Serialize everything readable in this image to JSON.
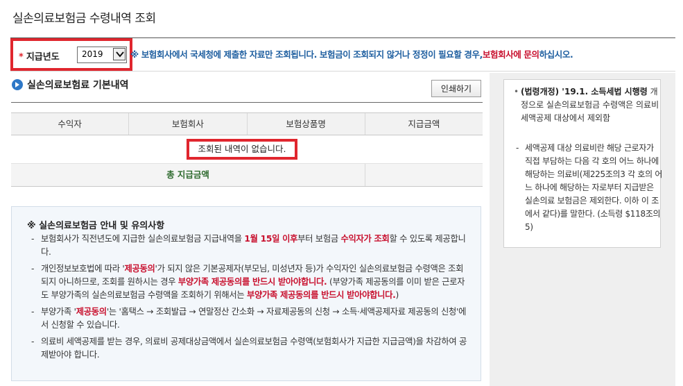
{
  "page": {
    "title": "실손의료보험금 수령내역 조회"
  },
  "filter": {
    "required_star": "*",
    "year_label": "지급년도",
    "year_value": "2019",
    "notice_part1": "※ 보험회사에서 국세청에 제출한 자료만 조회됩니다. 보험금이 조회되지 않거나 정정이 필요할 경우,",
    "notice_part2": "보험회사에 문의",
    "notice_part3": "하십시오."
  },
  "section": {
    "title": "실손의료보험료 기본내역",
    "print_label": "인쇄하기"
  },
  "table": {
    "columns": [
      "수익자",
      "보험회사",
      "보험상품명",
      "지급금액"
    ],
    "empty_text": "조회된 내역이 없습니다.",
    "total_label": "총 지급금액",
    "total_value": ""
  },
  "info": {
    "title": "※ 실손의료보험금 안내 및 유의사항",
    "item1": {
      "a": "보험회사가 직전년도에 지급한 실손의료보험금 지급내역을 ",
      "b": "1월 15일 이후",
      "c": "부터 보험금 ",
      "d": "수익자가 조회",
      "e": "할 수 있도록 제공합니다."
    },
    "item2": {
      "a": "개인정보보호법에 따라 '",
      "b": "제공동의",
      "c": "'가 되지 않은 기본공제자(부모님, 미성년자 등)가 수익자인 실손의료보험금 수령액은 조회되지 아니하므로, 조회를 원하시는 경우 ",
      "d": "부양가족 제공동의를 반드시 받아야합니다.",
      "e": " (부양가족 제공동의를 이미 받은 근로자도 부양가족의 실손의료보험금 수령액을 조회하기 위해서는 ",
      "f": "부양가족 제공동의를 반드시 받아야합니다.",
      "g": ")"
    },
    "item3": {
      "a": "부양가족 '",
      "b": "제공동의",
      "c": "'는 '홈택스 → 조회발급 → 연말정산 간소화 → 자료제공동의 신청 → 소득·세액공제자료 제공동의 신청'에서 신청할 수 있습니다."
    },
    "item4": "의료비 세액공제를 받는 경우, 의료비 공제대상금액에서 실손의료보험금 수령액(보험회사가 지급한 지급금액)을 차감하여 공제받아야 합니다."
  },
  "side": {
    "law_bold": "(법령개정) '19.1. 소득세법 시행령",
    "law_rest": " 개정으로 실손의료보험금 수령액은 의료비 세액공제 대상에서 제외함",
    "detail": "세액공제 대상 의료비란 해당 근로자가 직접 부담하는 다음 각 호의 어느 하나에 해당하는 의료비(제225조의3 각 호의 어느 하나에 해당하는 자로부터 지급받은 실손의료 보험금은 제외한다. 이하 이 조에서 같다)를 말한다. (소득령 $118조의5)"
  }
}
